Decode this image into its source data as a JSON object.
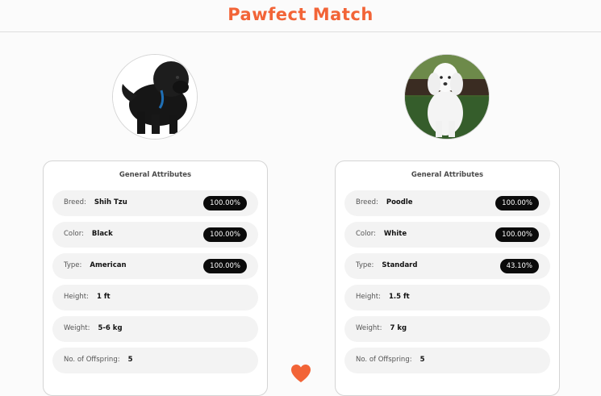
{
  "app": {
    "title": "Pawfect Match"
  },
  "colors": {
    "accent": "#f26437",
    "badge_bg": "#0b0b0b",
    "row_bg": "#f3f3f3"
  },
  "left": {
    "title": "General Attributes",
    "rows": [
      {
        "label": "Breed:",
        "value": "Shih Tzu",
        "badge": "100.00%"
      },
      {
        "label": "Color:",
        "value": "Black",
        "badge": "100.00%"
      },
      {
        "label": "Type:",
        "value": "American",
        "badge": "100.00%"
      },
      {
        "label": "Height:",
        "value": "1 ft"
      },
      {
        "label": "Weight:",
        "value": "5-6 kg"
      },
      {
        "label": "No. of Offspring:",
        "value": "5"
      }
    ]
  },
  "right": {
    "title": "General Attributes",
    "rows": [
      {
        "label": "Breed:",
        "value": "Poodle",
        "badge": "100.00%"
      },
      {
        "label": "Color:",
        "value": "White",
        "badge": "100.00%"
      },
      {
        "label": "Type:",
        "value": "Standard",
        "badge": "43.10%"
      },
      {
        "label": "Height:",
        "value": "1.5 ft"
      },
      {
        "label": "Weight:",
        "value": "7 kg"
      },
      {
        "label": "No. of Offspring:",
        "value": "5"
      }
    ]
  },
  "icons": {
    "match": "heart-icon"
  }
}
